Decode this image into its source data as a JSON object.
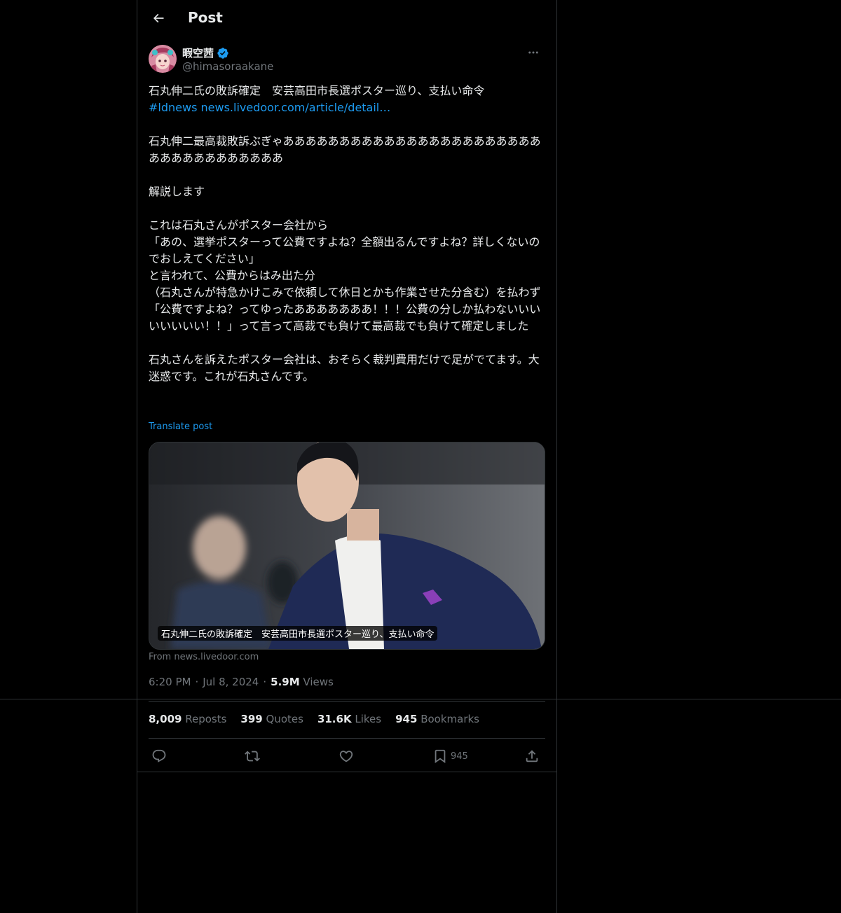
{
  "header": {
    "title": "Post"
  },
  "author": {
    "display_name": "暇空茜",
    "handle": "@himasoraakane",
    "verified": true
  },
  "tweet": {
    "line1": "石丸伸二氏の敗訴確定　安芸高田市長選ポスター巡り、支払い命令",
    "hashtag": "#ldnews",
    "url": "news.livedoor.com/article/detail…",
    "body": "\n\n石丸伸二最高裁敗訴ぶぎゃあああああああああああああああああああああああああああああああああああ\n\n解説します\n\nこれは石丸さんがポスター会社から\n「あの、選挙ポスターって公費ですよね？全額出るんですよね？詳しくないのでおしえてください」\nと言われて、公費からはみ出た分\n（石丸さんが特急かけこみで依頼して休日とかも作業させた分含む）を払わず\n「公費ですよね？ってゆったあああああああ！！！公費の分しか払わないいいいいいいい！！」って言って高裁でも負けて最高裁でも負けて確定しました\n\n石丸さんを訴えたポスター会社は、おそらく裁判費用だけで足がでてます。大迷惑です。これが石丸さんです。",
    "translate_label": "Translate post"
  },
  "card": {
    "caption": "石丸伸二氏の敗訴確定　安芸高田市長選ポスター巡り、支払い命令",
    "source": "From news.livedoor.com"
  },
  "meta": {
    "time": "6:20 PM",
    "date": "Jul 8, 2024",
    "views_count": "5.9M",
    "views_label": "Views"
  },
  "stats": {
    "reposts_count": "8,009",
    "reposts_label": "Reposts",
    "quotes_count": "399",
    "quotes_label": "Quotes",
    "likes_count": "31.6K",
    "likes_label": "Likes",
    "bookmarks_count": "945",
    "bookmarks_label": "Bookmarks"
  },
  "actions": {
    "bookmark_count": "945"
  },
  "colors": {
    "background": "#000000",
    "text": "#e7e9ea",
    "secondary": "#71767b",
    "accent": "#1d9bf0",
    "border": "#2f3336"
  },
  "icons": {
    "back": "arrow-left-icon",
    "verified": "verified-badge-icon",
    "more": "more-horizontal-icon",
    "reply": "reply-icon",
    "repost": "repost-icon",
    "like": "heart-icon",
    "bookmark": "bookmark-icon",
    "share": "share-icon"
  }
}
